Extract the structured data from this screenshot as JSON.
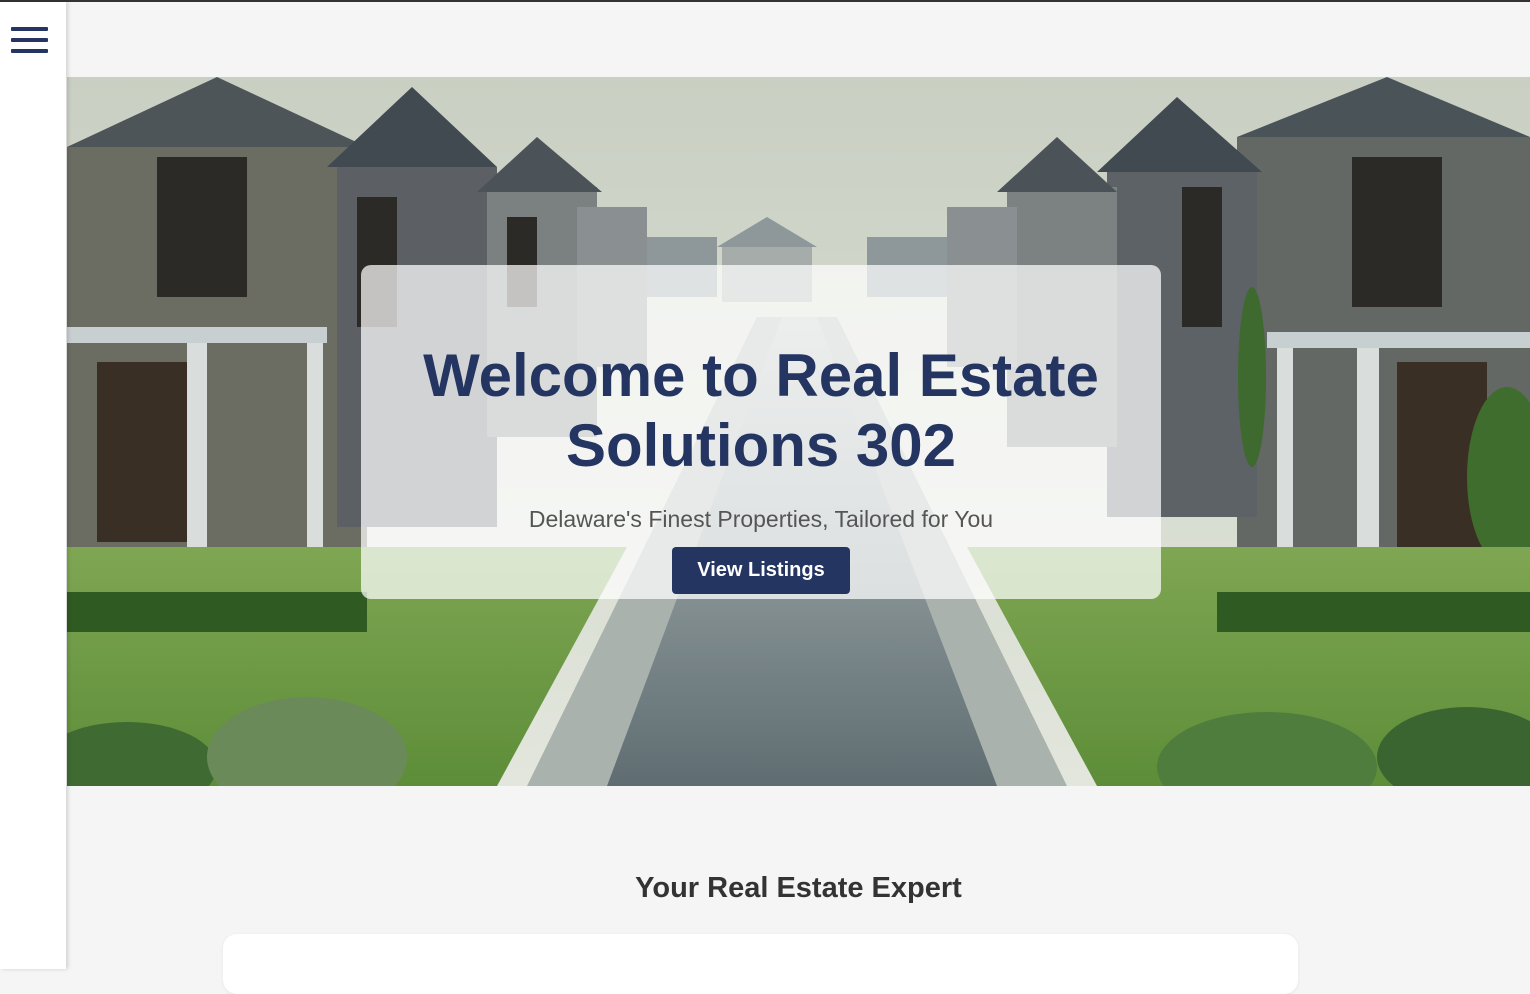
{
  "nav": {
    "menu_icon": "hamburger-menu-icon"
  },
  "hero": {
    "title_line1": "Welcome to Real Estate",
    "title_line2": "Solutions 302",
    "subtitle": "Delaware's Finest Properties, Tailored for You",
    "button_label": "View Listings"
  },
  "expert_section": {
    "title": "Your Real Estate Expert"
  },
  "colors": {
    "brand_navy": "#253561",
    "page_bg": "#f5f5f5"
  }
}
